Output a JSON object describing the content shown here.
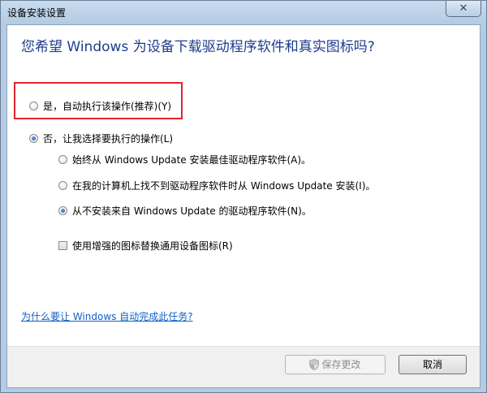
{
  "window": {
    "title": "设备安装设置",
    "close_symbol": "✕"
  },
  "heading": "您希望 Windows 为设备下载驱动程序软件和真实图标吗?",
  "options": {
    "auto": {
      "label": "是，自动执行该操作(推荐)(Y)",
      "checked": false
    },
    "manual": {
      "label": "否，让我选择要执行的操作(L)",
      "checked": true
    },
    "sub": [
      {
        "label": "始终从 Windows Update 安装最佳驱动程序软件(A)。",
        "checked": false
      },
      {
        "label": "在我的计算机上找不到驱动程序软件时从 Windows Update 安装(I)。",
        "checked": false
      },
      {
        "label": "从不安装来自 Windows Update 的驱动程序软件(N)。",
        "checked": true
      }
    ],
    "enhanced_icons": {
      "label": "使用增强的图标替换通用设备图标(R)",
      "checked": false
    }
  },
  "help_link": "为什么要让 Windows 自动完成此任务?",
  "buttons": {
    "save": {
      "label": "保存更改",
      "enabled": false,
      "icon": "uac-shield-icon"
    },
    "cancel": {
      "label": "取消",
      "enabled": true
    }
  },
  "colors": {
    "heading": "#1e3c8c",
    "link": "#1060c8",
    "highlight": "#e0262c"
  }
}
